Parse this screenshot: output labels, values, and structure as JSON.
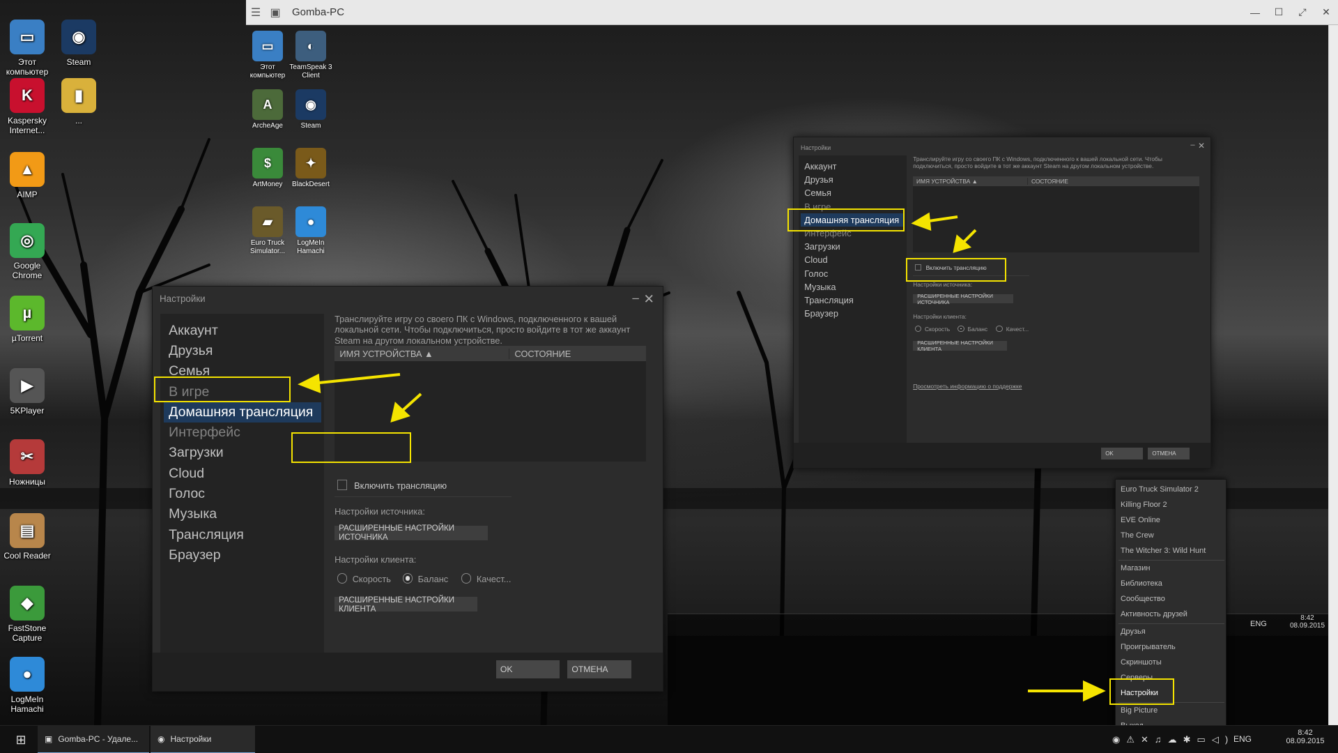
{
  "remote_window": {
    "title": "Gomba-PC"
  },
  "desktop_icons": [
    {
      "label": "Этот компьютер",
      "icon": "computer-icon",
      "glyph": "▭",
      "color": "#3a7fc4"
    },
    {
      "label": "Steam",
      "icon": "steam-icon",
      "glyph": "◉",
      "color": "#1b3a63"
    },
    {
      "label": "Kaspersky Internet...",
      "icon": "kaspersky-icon",
      "glyph": "K",
      "color": "#c8102e"
    },
    {
      "label": "...",
      "icon": "folder-icon",
      "glyph": "▮",
      "color": "#d9b13b"
    },
    {
      "label": "AIMP",
      "icon": "aimp-icon",
      "glyph": "▲",
      "color": "#f29a16"
    },
    {
      "label": "Google Chrome",
      "icon": "chrome-icon",
      "glyph": "◎",
      "color": "#34a853"
    },
    {
      "label": "µTorrent",
      "icon": "utorrent-icon",
      "glyph": "µ",
      "color": "#5cb82c"
    },
    {
      "label": "5KPlayer",
      "icon": "5kplayer-icon",
      "glyph": "▶",
      "color": "#555555"
    },
    {
      "label": "Ножницы",
      "icon": "scissors-icon",
      "glyph": "✂",
      "color": "#b53a3a"
    },
    {
      "label": "Cool Reader",
      "icon": "book-icon",
      "glyph": "▤",
      "color": "#b8864b"
    },
    {
      "label": "FastStone Capture",
      "icon": "faststone-icon",
      "glyph": "◆",
      "color": "#3b9a3b"
    },
    {
      "label": "LogMeIn Hamachi",
      "icon": "hamachi-icon",
      "glyph": "●",
      "color": "#2e8ad8"
    }
  ],
  "remote_icons": [
    {
      "label": "Этот компьютер",
      "icon": "computer-icon",
      "glyph": "▭",
      "color": "#3a7fc4"
    },
    {
      "label": "TeamSpeak 3 Client",
      "icon": "teamspeak-icon",
      "glyph": "◐",
      "color": "#3d5e7e"
    },
    {
      "label": "ArcheAge",
      "icon": "archeage-icon",
      "glyph": "A",
      "color": "#4c6a3a"
    },
    {
      "label": "Steam",
      "icon": "steam-icon",
      "glyph": "◉",
      "color": "#1b3a63"
    },
    {
      "label": "ArtMoney",
      "icon": "artmoney-icon",
      "glyph": "$",
      "color": "#3a8a3a"
    },
    {
      "label": "BlackDesert",
      "icon": "blackdesert-icon",
      "glyph": "✦",
      "color": "#7a5a1a"
    },
    {
      "label": "Euro Truck Simulator...",
      "icon": "ets2-icon",
      "glyph": "▰",
      "color": "#6a5a2a"
    },
    {
      "label": "LogMeIn Hamachi",
      "icon": "hamachi-icon",
      "glyph": "●",
      "color": "#2e8ad8"
    }
  ],
  "settings": {
    "title": "Настройки",
    "nav": [
      "Аккаунт",
      "Друзья",
      "Семья",
      "В игре",
      "Домашняя трансляция",
      "Интерфейс",
      "Загрузки",
      "Cloud",
      "Голос",
      "Музыка",
      "Трансляция",
      "Браузер"
    ],
    "selected_index": 4,
    "description": "Транслируйте игру со своего ПК с Windows, подключенного к вашей локальной сети. Чтобы подключиться, просто войдите в тот же аккаунт Steam на другом локальном устройстве.",
    "col_device": "ИМЯ УСТРОЙСТВА",
    "col_status": "СОСТОЯНИЕ",
    "enable_label": "Включить трансляцию",
    "source_label": "Настройки источника:",
    "source_button": "РАСШИРЕННЫЕ НАСТРОЙКИ ИСТОЧНИКА",
    "client_label": "Настройки клиента:",
    "radios": [
      "Скорость",
      "Баланс",
      "Качест..."
    ],
    "radio_selected": 1,
    "client_button": "РАСШИРЕННЫЕ НАСТРОЙКИ КЛИЕНТА",
    "support_link": "Просмотреть информацию о поддержке",
    "ok": "OK",
    "cancel": "ОТМЕНА"
  },
  "tray_menu": {
    "games": [
      "Euro Truck Simulator 2",
      "Killing Floor 2",
      "EVE Online",
      "The Crew",
      "The Witcher 3: Wild Hunt"
    ],
    "nav1": [
      "Магазин",
      "Библиотека",
      "Сообщество",
      "Активность друзей"
    ],
    "nav2": [
      "Друзья",
      "Проигрыватель",
      "Скриншоты",
      "Серверы",
      "Настройки"
    ],
    "nav3": [
      "Big Picture",
      "Выход"
    ],
    "highlighted": "Настройки"
  },
  "taskbar": {
    "items": [
      "Gomba-PC - Удале...",
      "Настройки"
    ],
    "lang": "ENG",
    "time": "8:42",
    "date": "08.09.2015"
  },
  "remote_tray": {
    "lang": "ENG",
    "time": "8:42",
    "date": "08.09.2015"
  },
  "colors": {
    "highlight": "#f5e400",
    "nav_selected": "#1e3a5c",
    "dialog_bg": "#2c2c2c"
  }
}
